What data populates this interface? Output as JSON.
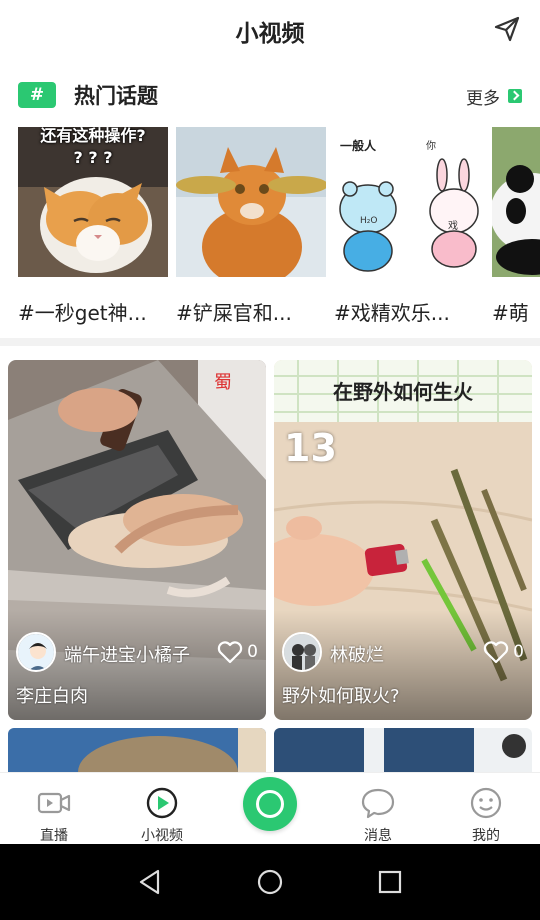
{
  "header": {
    "title": "小视频"
  },
  "hot_topics": {
    "title": "热门话题",
    "more_label": "更多",
    "items": [
      {
        "label": "#一秒get神...",
        "caption": "还有这种操作?\n? ? ?"
      },
      {
        "label": "#铲屎官和...",
        "caption": ""
      },
      {
        "label": "#戏精欢乐...",
        "caption": "一般人"
      },
      {
        "label": "#萌",
        "caption": ""
      }
    ]
  },
  "cards": [
    {
      "author": "端午进宝小橘子",
      "likes": "0",
      "title": "李庄白肉",
      "overlay_text": ""
    },
    {
      "author": "林破烂",
      "likes": "0",
      "title": "野外如何取火?",
      "overlay_text": "在野外如何生火",
      "badge": "13"
    }
  ],
  "bottom_nav": [
    {
      "label": "直播",
      "icon": "live-video-icon"
    },
    {
      "label": "小视频",
      "icon": "play-circle-icon"
    },
    {
      "label": "",
      "icon": "camera-record-icon"
    },
    {
      "label": "消息",
      "icon": "chat-bubble-icon"
    },
    {
      "label": "我的",
      "icon": "smiley-face-icon"
    }
  ],
  "colors": {
    "accent": "#2bc872",
    "text": "#222222",
    "system_bar": "#000000"
  }
}
